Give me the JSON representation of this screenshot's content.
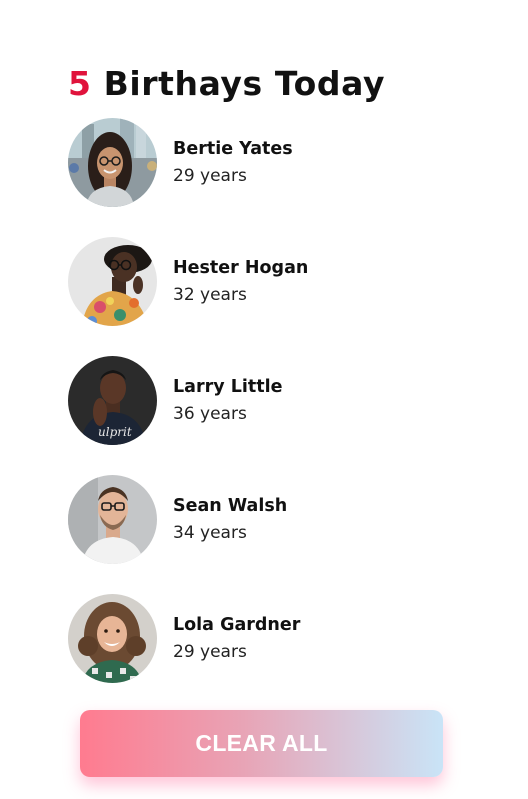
{
  "header": {
    "count": "5",
    "title": "Birthays Today"
  },
  "people": [
    {
      "name": "Bertie Yates",
      "age": "29 years",
      "avatar": "woman-with-glasses-photo"
    },
    {
      "name": "Hester Hogan",
      "age": "32 years",
      "avatar": "woman-with-glasses-floral-shirt-photo"
    },
    {
      "name": "Larry Little",
      "age": "36 years",
      "avatar": "man-dark-tshirt-photo"
    },
    {
      "name": "Sean Walsh",
      "age": "34 years",
      "avatar": "man-with-glasses-photo"
    },
    {
      "name": "Lola Gardner",
      "age": "29 years",
      "avatar": "smiling-woman-curly-hair-photo"
    }
  ],
  "actions": {
    "clear_label": "CLEAR ALL"
  },
  "colors": {
    "accent": "#e0133c",
    "button_gradient_start": "#ff7b8f",
    "button_gradient_end": "#c9e4f7"
  }
}
